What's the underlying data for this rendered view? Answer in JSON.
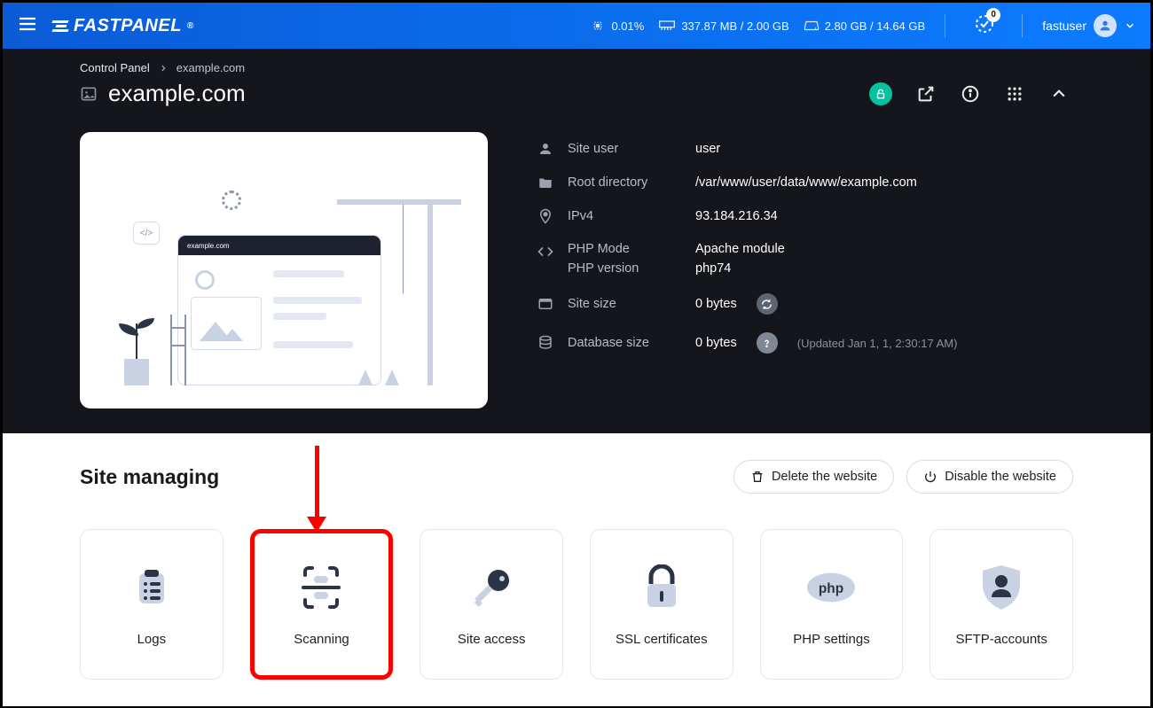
{
  "brand": "FASTPANEL",
  "topbar": {
    "cpu": "0.01%",
    "ram": "337.87 MB / 2.00 GB",
    "disk": "2.80 GB / 14.64 GB",
    "tasks_badge": "0",
    "username": "fastuser"
  },
  "breadcrumb": {
    "root": "Control Panel",
    "current": "example.com"
  },
  "page_title": "example.com",
  "preview_url_label": "example.com",
  "info": {
    "site_user": {
      "label": "Site user",
      "value": "user"
    },
    "root_dir": {
      "label": "Root directory",
      "value": "/var/www/user/data/www/example.com"
    },
    "ipv4": {
      "label": "IPv4",
      "value": "93.184.216.34"
    },
    "php_mode": {
      "label1": "PHP Mode",
      "label2": "PHP version",
      "value1": "Apache module",
      "value2": "php74"
    },
    "site_size": {
      "label": "Site size",
      "value": "0 bytes"
    },
    "db_size": {
      "label": "Database size",
      "value": "0 bytes",
      "updated": "(Updated Jan 1, 1, 2:30:17 AM)"
    }
  },
  "section_title": "Site managing",
  "actions": {
    "delete": "Delete the website",
    "disable": "Disable the website"
  },
  "cards": {
    "logs": "Logs",
    "scanning": "Scanning",
    "site_access": "Site access",
    "ssl": "SSL certificates",
    "php": "PHP settings",
    "sftp": "SFTP-accounts"
  }
}
